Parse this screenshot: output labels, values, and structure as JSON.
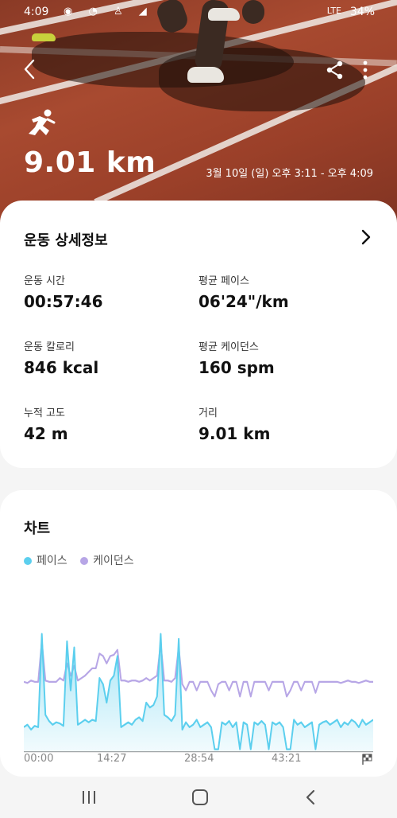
{
  "status_bar": {
    "time": "4:09",
    "network": "LTE",
    "battery": "34%"
  },
  "header": {
    "distance": "9.01 km",
    "date_range": "3월 10일 (일) 오후 3:11 - 오후 4:09",
    "activity_icon": "running-person-icon"
  },
  "details": {
    "title": "운동 상세정보",
    "stats": [
      {
        "label": "운동 시간",
        "value": "00:57:46"
      },
      {
        "label": "평균 페이스",
        "value": "06'24\"/km"
      },
      {
        "label": "운동 칼로리",
        "value": "846 kcal"
      },
      {
        "label": "평균 케이던스",
        "value": "160 spm"
      },
      {
        "label": "누적 고도",
        "value": "42 m"
      },
      {
        "label": "거리",
        "value": "9.01 km"
      }
    ]
  },
  "chart_section": {
    "title": "차트",
    "legend": [
      {
        "name": "페이스",
        "color": "#5ccfee"
      },
      {
        "name": "케이던스",
        "color": "#b7a6e6"
      }
    ]
  },
  "chart_data": {
    "type": "line",
    "x_ticks": [
      "00:00",
      "14:27",
      "28:54",
      "43:21"
    ],
    "series": [
      {
        "name": "페이스",
        "color": "#5ccfee",
        "values": [
          0.2,
          0.22,
          0.18,
          0.21,
          0.2,
          0.96,
          0.3,
          0.25,
          0.22,
          0.24,
          0.23,
          0.21,
          0.9,
          0.5,
          0.85,
          0.22,
          0.24,
          0.26,
          0.24,
          0.26,
          0.25,
          0.6,
          0.55,
          0.4,
          0.58,
          0.62,
          0.78,
          0.2,
          0.22,
          0.24,
          0.22,
          0.26,
          0.28,
          0.25,
          0.4,
          0.36,
          0.38,
          0.45,
          0.96,
          0.3,
          0.28,
          0.25,
          0.3,
          0.92,
          0.18,
          0.24,
          0.2,
          0.22,
          0.26,
          0.2,
          0.22,
          0.24,
          0.2,
          0.02,
          0.02,
          0.24,
          0.22,
          0.25,
          0.2,
          0.24,
          0.02,
          0.24,
          0.22,
          0.02,
          0.24,
          0.22,
          0.25,
          0.22,
          0.02,
          0.24,
          0.22,
          0.24,
          0.2,
          0.02,
          0.02,
          0.26,
          0.22,
          0.24,
          0.2,
          0.22,
          0.24,
          0.02,
          0.22,
          0.24,
          0.25,
          0.22,
          0.24,
          0.26,
          0.2,
          0.24,
          0.22,
          0.26,
          0.24,
          0.2,
          0.26,
          0.22,
          0.24,
          0.26
        ]
      },
      {
        "name": "케이던스",
        "color": "#b7a6e6",
        "values": [
          0.57,
          0.56,
          0.58,
          0.57,
          0.57,
          0.9,
          0.58,
          0.57,
          0.57,
          0.57,
          0.6,
          0.58,
          0.72,
          0.62,
          0.7,
          0.58,
          0.6,
          0.62,
          0.65,
          0.68,
          0.68,
          0.8,
          0.78,
          0.72,
          0.78,
          0.79,
          0.83,
          0.58,
          0.58,
          0.57,
          0.58,
          0.58,
          0.57,
          0.58,
          0.6,
          0.58,
          0.6,
          0.62,
          0.88,
          0.58,
          0.58,
          0.57,
          0.6,
          0.85,
          0.55,
          0.5,
          0.57,
          0.57,
          0.5,
          0.57,
          0.57,
          0.57,
          0.5,
          0.45,
          0.55,
          0.57,
          0.57,
          0.5,
          0.57,
          0.57,
          0.45,
          0.57,
          0.57,
          0.45,
          0.57,
          0.57,
          0.57,
          0.57,
          0.5,
          0.57,
          0.57,
          0.57,
          0.57,
          0.45,
          0.5,
          0.57,
          0.57,
          0.5,
          0.57,
          0.57,
          0.57,
          0.48,
          0.57,
          0.57,
          0.57,
          0.57,
          0.57,
          0.57,
          0.56,
          0.57,
          0.58,
          0.57,
          0.57,
          0.56,
          0.57,
          0.58,
          0.57,
          0.57
        ]
      }
    ],
    "ylim": [
      0,
      1
    ],
    "grid": false,
    "legend_position": "top-left"
  },
  "nav": {
    "recent": "recents-icon",
    "home": "home-icon",
    "back": "back-icon"
  }
}
